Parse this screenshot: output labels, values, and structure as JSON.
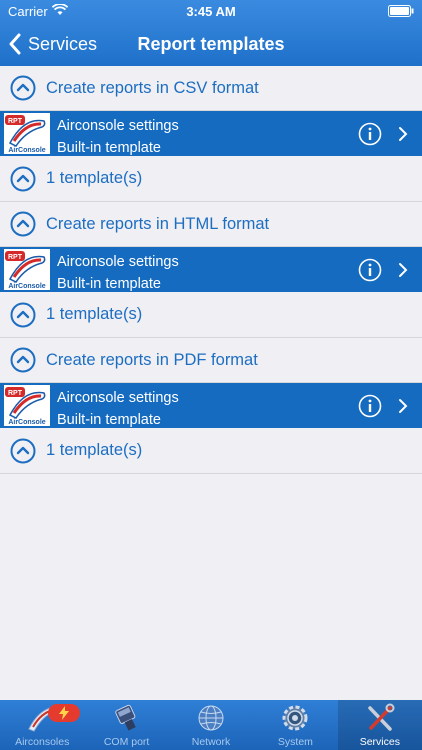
{
  "status_bar": {
    "carrier": "Carrier",
    "time": "3:45 AM"
  },
  "nav": {
    "back_label": "Services",
    "title": "Report templates"
  },
  "groups": [
    {
      "title": "Create reports in CSV format",
      "item": {
        "name": "Airconsole settings",
        "subtitle": "Built-in template"
      },
      "footer": "1 template(s)"
    },
    {
      "title": "Create reports in HTML format",
      "item": {
        "name": "Airconsole settings",
        "subtitle": "Built-in template"
      },
      "footer": "1 template(s)"
    },
    {
      "title": "Create reports in PDF format",
      "item": {
        "name": "Airconsole settings",
        "subtitle": "Built-in template"
      },
      "footer": "1 template(s)"
    }
  ],
  "logo": {
    "top_text": "RPT",
    "bottom_text": "AirConsole"
  },
  "tabs": [
    {
      "label": "Airconsoles",
      "icon": "airconsole-icon"
    },
    {
      "label": "COM port",
      "icon": "com-port-icon"
    },
    {
      "label": "Network",
      "icon": "network-globe-icon"
    },
    {
      "label": "System",
      "icon": "system-gear-icon"
    },
    {
      "label": "Services",
      "icon": "services-tools-icon"
    }
  ],
  "selected_tab": "Services",
  "colors": {
    "accent": "#1d6ec1",
    "row_background": "#156bc0",
    "nav_background": "#2a7fd8",
    "badge": "#e53b2f"
  }
}
